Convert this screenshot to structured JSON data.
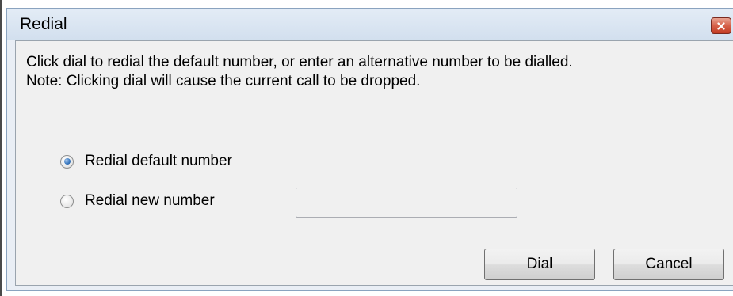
{
  "window": {
    "title": "Redial",
    "close_icon": "close-x-icon"
  },
  "instructions": {
    "line1": "Click dial to redial the default number, or enter an alternative number to be dialled.",
    "line2": "Note: Clicking dial will cause the current call to be dropped."
  },
  "options": {
    "default_label": "Redial default number",
    "default_selected": true,
    "new_label": "Redial new number",
    "new_selected": false
  },
  "new_number": {
    "value": "",
    "placeholder": ""
  },
  "buttons": {
    "dial": "Dial",
    "cancel": "Cancel"
  },
  "colors": {
    "close_button": "#c33c24",
    "radio_selected": "#3c7bc2"
  }
}
